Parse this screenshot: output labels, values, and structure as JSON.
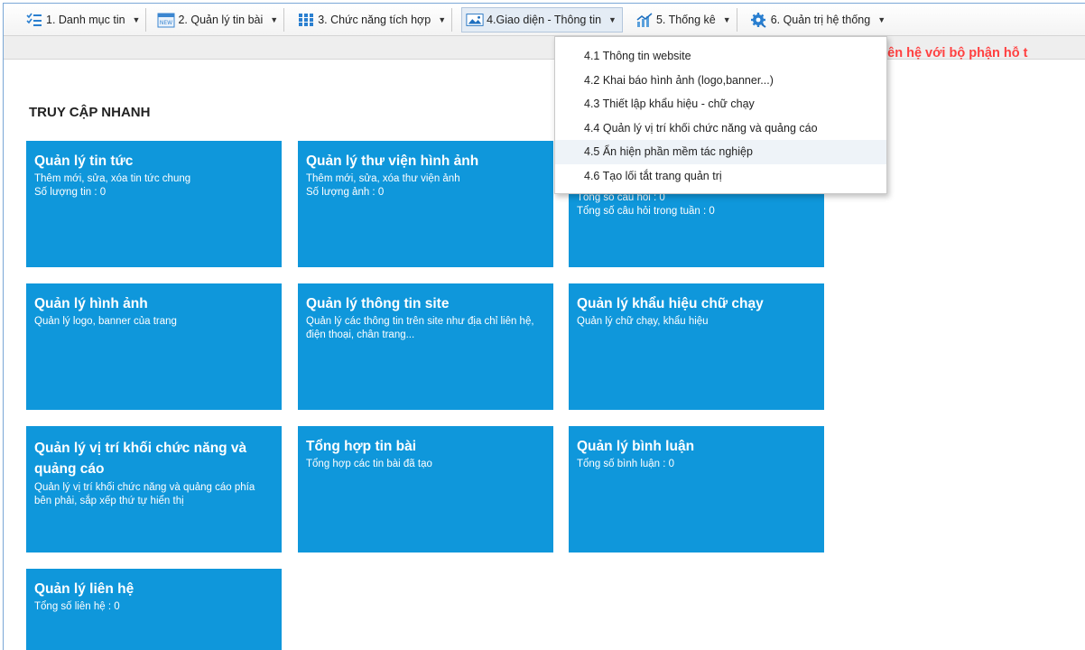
{
  "menu": {
    "items": [
      {
        "label": "1. Danh mục tin",
        "icon": "list-icon"
      },
      {
        "label": "2. Quản lý tin bài",
        "icon": "news-icon"
      },
      {
        "label": "3. Chức năng tích hợp",
        "icon": "grid-icon"
      },
      {
        "label": "4.Giao diện - Thông tin",
        "icon": "image-icon"
      },
      {
        "label": "5. Thống kê",
        "icon": "chart-icon"
      },
      {
        "label": "6. Quản trị hệ thống",
        "icon": "settings-icon"
      }
    ]
  },
  "notice": {
    "text": "ể liên hệ với bộ phận hỗ t"
  },
  "dropdown": {
    "items": [
      "4.1 Thông tin website",
      "4.2 Khai báo hình ảnh (logo,banner...)",
      "4.3 Thiết lập khẩu hiệu - chữ chạy",
      "4.4 Quản lý vị trí khối chức năng và quảng cáo",
      "4.5 Ẩn hiện phần mềm tác nghiệp",
      "4.6 Tạo lối tắt trang quản trị"
    ]
  },
  "quick_access": {
    "title": "TRUY CẬP NHANH",
    "tiles": [
      {
        "title": "Quản lý tin tức",
        "lines": [
          "Thêm mới, sửa, xóa tin tức chung",
          "Số lượng tin : 0"
        ]
      },
      {
        "title": "Quản lý thư viện hình ảnh",
        "lines": [
          "Thêm mới, sửa, xóa thư viện ảnh",
          "Số lượng ảnh : 0"
        ]
      },
      {
        "title": "",
        "lines": [
          "Tổng số câu hỏi : 0",
          "Tổng số câu hỏi trong tuần : 0"
        ]
      },
      {
        "title": "Quản lý hình ảnh",
        "lines": [
          "Quản lý logo, banner của trang"
        ]
      },
      {
        "title": "Quản lý thông tin site",
        "lines": [
          "Quản lý các thông tin trên site như địa chỉ liên hệ, điện thoại, chân trang..."
        ]
      },
      {
        "title": "Quản lý khẩu hiệu chữ chạy",
        "lines": [
          "Quản lý chữ chạy, khẩu hiệu"
        ]
      },
      {
        "title": "Quản lý vị trí khối chức năng và quảng cáo",
        "lines": [
          "Quản lý vị trí khối chức năng và quảng cáo phía bên phải, sắp xếp thứ tự hiển thị"
        ]
      },
      {
        "title": "Tổng hợp tin bài",
        "lines": [
          "Tổng hợp các tin bài đã tạo"
        ]
      },
      {
        "title": "Quản lý bình luận",
        "lines": [
          "Tổng số bình luận : 0"
        ]
      },
      {
        "title": "Quản lý liên hệ",
        "lines": [
          "Tổng số liên hệ : 0"
        ]
      }
    ]
  },
  "colors": {
    "tile_bg": "#0f97db",
    "notice": "#ff4040"
  }
}
